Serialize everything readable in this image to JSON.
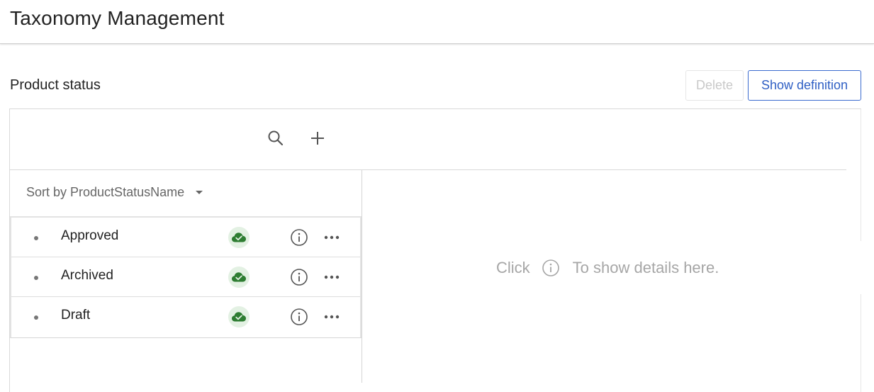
{
  "app": {
    "title": "Taxonomy Management"
  },
  "section": {
    "title": "Product status"
  },
  "actions": {
    "delete_label": "Delete",
    "show_definition_label": "Show definition"
  },
  "toolbar": {
    "icons": [
      "search-icon",
      "plus-icon"
    ]
  },
  "sort": {
    "label": "Sort by ProductStatusName"
  },
  "items": [
    {
      "label": "Approved",
      "status_icon": "cloud-check-icon"
    },
    {
      "label": "Archived",
      "status_icon": "cloud-check-icon"
    },
    {
      "label": "Draft",
      "status_icon": "cloud-check-icon"
    }
  ],
  "details": {
    "prefix": "Click",
    "suffix": "To show details here."
  },
  "colors": {
    "accent": "#2f5fc4",
    "status_green": "#2e7d32",
    "status_bg": "#e3f1e3",
    "muted": "#a6a6a6"
  }
}
